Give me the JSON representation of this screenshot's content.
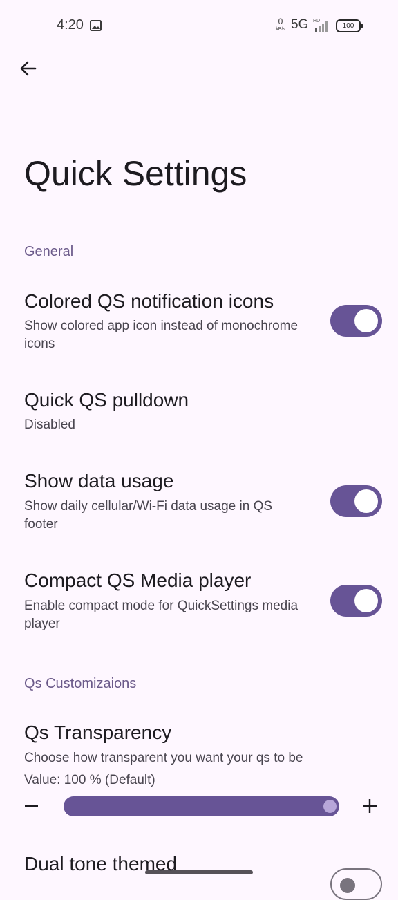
{
  "status_bar": {
    "time": "4:20",
    "net_speed_value": "0",
    "net_speed_unit": "kB/s",
    "network_type": "5G",
    "hd_label": "HD",
    "battery_level": "100"
  },
  "header": {
    "title": "Quick Settings"
  },
  "sections": {
    "general": {
      "label": "General"
    },
    "customizations": {
      "label": "Qs Customizaions"
    }
  },
  "prefs": {
    "colored_icons": {
      "title": "Colored QS notification icons",
      "summary": "Show colored app icon instead of monochrome icons",
      "enabled": true
    },
    "quick_pulldown": {
      "title": "Quick QS pulldown",
      "summary": "Disabled"
    },
    "data_usage": {
      "title": "Show data usage",
      "summary": "Show daily cellular/Wi-Fi data usage in QS footer",
      "enabled": true
    },
    "compact_media": {
      "title": "Compact QS Media player",
      "summary": "Enable compact mode for QuickSettings media player",
      "enabled": true
    },
    "transparency": {
      "title": "Qs Transparency",
      "summary": "Choose how transparent you want your qs to be",
      "value_text": "Value: 100 % (Default)",
      "value_percent": 100
    },
    "dual_tone": {
      "title": "Dual tone themed",
      "enabled": false
    }
  },
  "colors": {
    "accent": "#675496",
    "background": "#fef7ff",
    "section_header": "#6b5a8a",
    "slider_thumb": "#b7a6d9"
  },
  "icons": {
    "back": "arrow-back-icon",
    "gallery": "image-icon",
    "minus": "minus-icon",
    "plus": "plus-icon"
  }
}
